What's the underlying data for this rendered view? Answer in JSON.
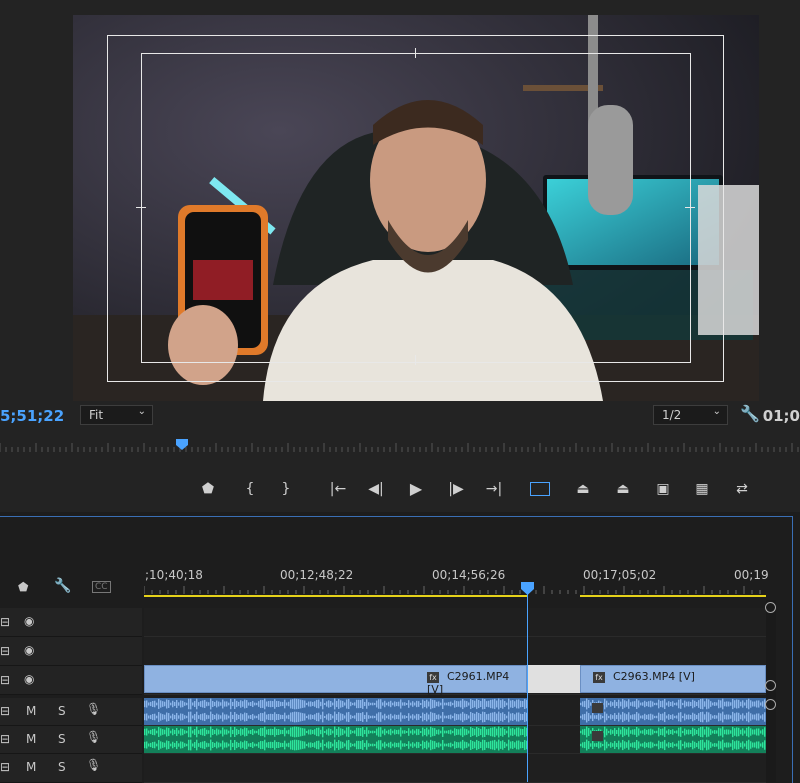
{
  "monitor": {
    "timecode_left": "5;51;22",
    "timecode_right": "01;0",
    "zoom_select": "Fit",
    "resolution_select": "1/2",
    "icons": {
      "settings": "wrench-icon"
    }
  },
  "transport": {
    "buttons": [
      {
        "name": "add-marker-button",
        "glyph": "⬟"
      },
      {
        "name": "mark-in-button",
        "glyph": "{"
      },
      {
        "name": "mark-out-button",
        "glyph": "}"
      },
      {
        "name": "go-to-in-button",
        "glyph": "|←"
      },
      {
        "name": "step-back-button",
        "glyph": "◀|"
      },
      {
        "name": "play-button",
        "glyph": "▶"
      },
      {
        "name": "step-forward-button",
        "glyph": "|▶"
      },
      {
        "name": "go-to-out-button",
        "glyph": "→|"
      },
      {
        "name": "safe-margins-button",
        "glyph": "▭"
      },
      {
        "name": "lift-button",
        "glyph": "⏏"
      },
      {
        "name": "extract-button",
        "glyph": "⏏"
      },
      {
        "name": "export-frame-button",
        "glyph": "📷"
      },
      {
        "name": "compare-view-button",
        "glyph": "▦"
      },
      {
        "name": "proxy-toggle-button",
        "glyph": "⇄"
      }
    ]
  },
  "timeline": {
    "header_icons": {
      "marker": "marker-icon",
      "wrench": "wrench-icon",
      "captions": "CC"
    },
    "timecodes": [
      ";10;40;18",
      "00;12;48;22",
      "00;14;56;26",
      "00;17;05;02",
      "00;19"
    ],
    "clips": [
      {
        "label": "C2961.MP4 [V]"
      },
      {
        "label": "C2963.MP4 [V]"
      }
    ],
    "audio_track_buttons": {
      "mute": "M",
      "solo": "S"
    }
  },
  "colors": {
    "accent": "#4aa3ff",
    "video_clip": "#8fb2e1",
    "audio_clip_1": "#5c8fcf",
    "audio_clip_2": "#1fbf82",
    "work_area": "#e6d21a"
  }
}
